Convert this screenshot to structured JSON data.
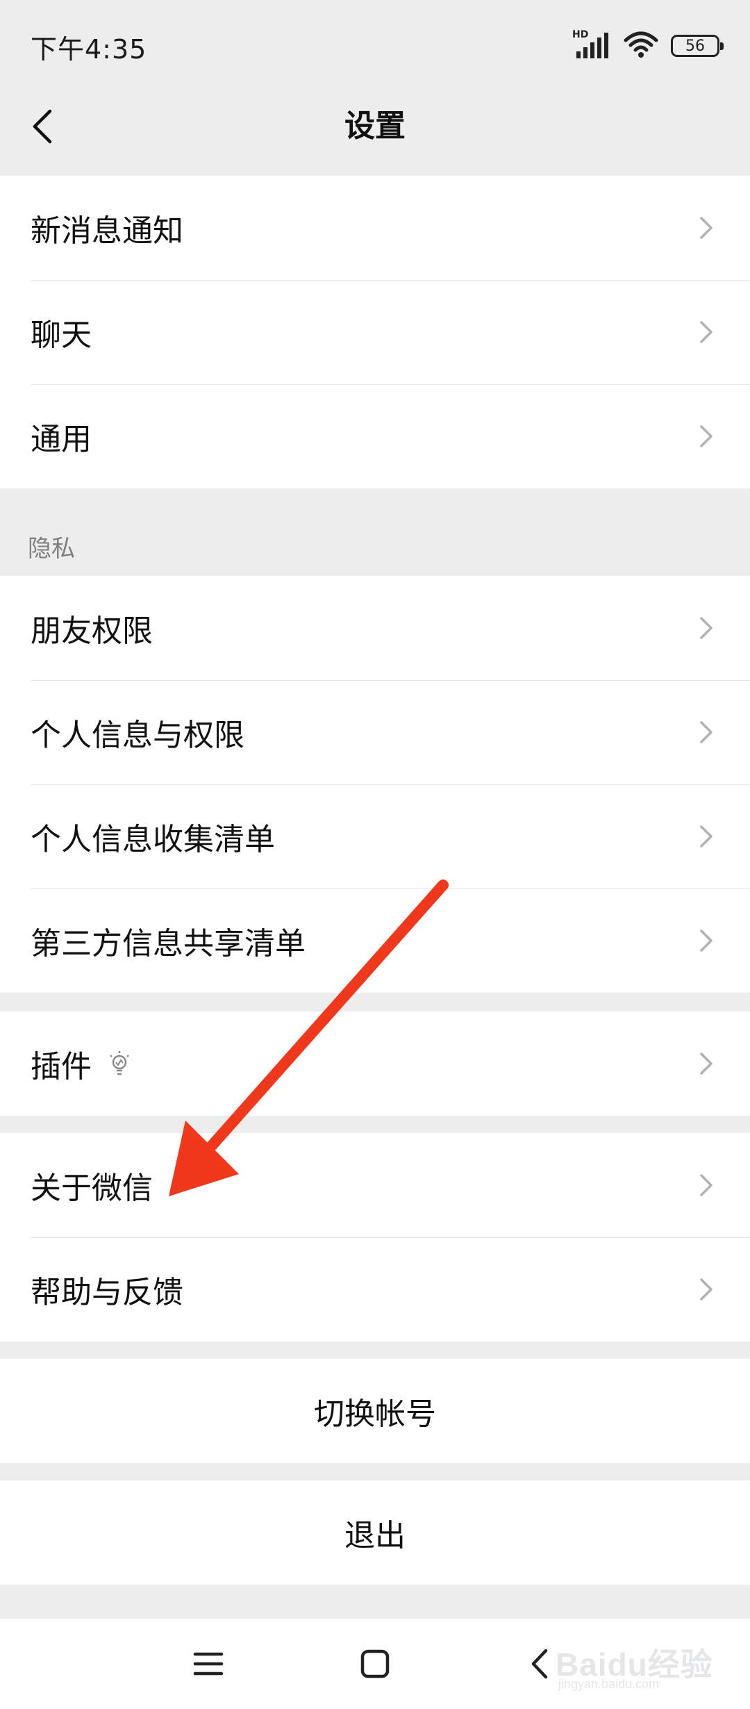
{
  "status_bar": {
    "time": "下午4:35",
    "network_label": "HD",
    "battery": "56"
  },
  "header": {
    "title": "设置",
    "back_icon": "chevron-left-icon"
  },
  "groups": {
    "general": [
      {
        "label": "新消息通知"
      },
      {
        "label": "聊天"
      },
      {
        "label": "通用"
      }
    ],
    "privacy_header": "隐私",
    "privacy": [
      {
        "label": "朋友权限"
      },
      {
        "label": "个人信息与权限"
      },
      {
        "label": "个人信息收集清单"
      },
      {
        "label": "第三方信息共享清单"
      }
    ],
    "plugins": {
      "label": "插件",
      "icon": "lightbulb-icon"
    },
    "about": [
      {
        "label": "关于微信"
      },
      {
        "label": "帮助与反馈"
      }
    ]
  },
  "actions": {
    "switch_account": "切换帐号",
    "logout": "退出"
  },
  "annotation": {
    "arrow_color": "#f0391c"
  },
  "system_nav": {
    "menu_icon": "menu-icon",
    "home_icon": "home-square-icon",
    "back_icon": "back-triangle-icon"
  },
  "watermark": {
    "text": "Baidu经验",
    "subtext": "jingyan.baidu.com"
  }
}
